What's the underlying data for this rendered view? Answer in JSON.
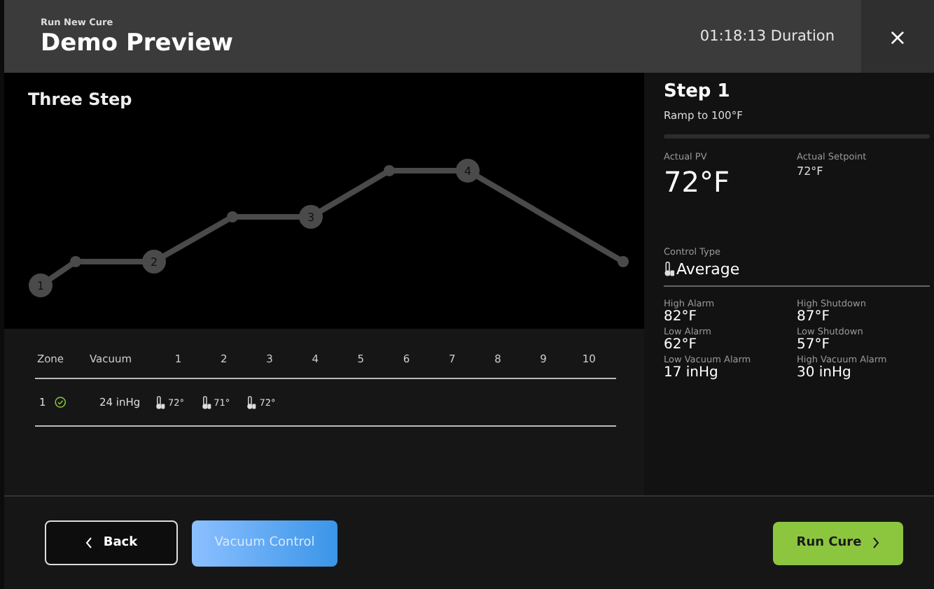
{
  "header": {
    "subtitle": "Run New Cure",
    "title": "Demo Preview",
    "duration": "01:18:13 Duration",
    "close": "×"
  },
  "profile": {
    "title": "Three Step",
    "steps": [
      "1",
      "2",
      "3",
      "4"
    ]
  },
  "table": {
    "columns": [
      "Zone",
      "Vacuum",
      "1",
      "2",
      "3",
      "4",
      "5",
      "6",
      "7",
      "8",
      "9",
      "10"
    ],
    "rows": [
      {
        "zone": "1",
        "ok": true,
        "vacuum": "24 inHg",
        "temps": [
          "72°",
          "71°",
          "72°"
        ]
      }
    ]
  },
  "step": {
    "title": "Step 1",
    "description": "Ramp to 100°F",
    "level": 0,
    "actual_pv_label": "Actual PV",
    "actual_pv": "72°F",
    "setpoint_label": "Actual Setpoint",
    "setpoint": "72°F",
    "control_type_label": "Control Type",
    "control_type": "Average",
    "limits": [
      {
        "label": "High Alarm",
        "value": "82°F"
      },
      {
        "label": "High Shutdown",
        "value": "87°F"
      },
      {
        "label": "Low Alarm",
        "value": "62°F"
      },
      {
        "label": "Low Shutdown",
        "value": "57°F"
      },
      {
        "label": "Low Vacuum Alarm",
        "value": "17 inHg"
      },
      {
        "label": "High Vacuum Alarm",
        "value": "30 inHg"
      }
    ]
  },
  "footer": {
    "back": "Back",
    "vacuum_control": {
      "label": "Vacuum Control",
      "disabled": true
    },
    "run": "Run Cure"
  }
}
